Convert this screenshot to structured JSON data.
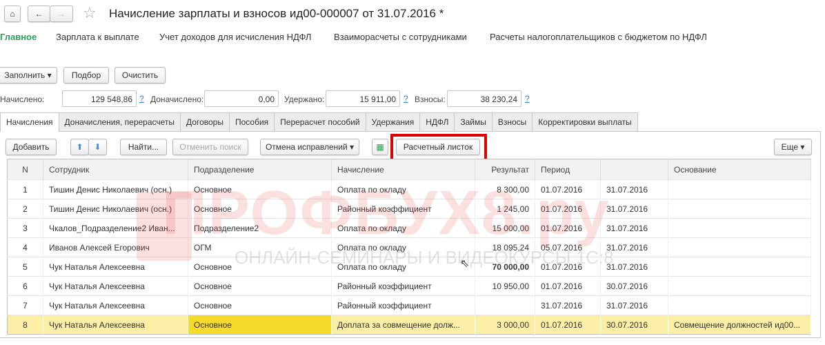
{
  "window": {
    "title": "Начисление зарплаты и взносов ид00-000007 от 31.07.2016 *"
  },
  "nav": [
    "Главное",
    "Зарплата к выплате",
    "Учет доходов для исчисления НДФЛ",
    "Взаиморасчеты с сотрудниками",
    "Расчеты налогоплательщиков с бюджетом по НДФЛ"
  ],
  "toolbar": {
    "fill": "Заполнить",
    "pick": "Подбор",
    "clear": "Очистить"
  },
  "totals": {
    "accrued_label": "Начислено:",
    "accrued": "129 548,86",
    "extra_label": "Доначислено:",
    "extra": "0,00",
    "withheld_label": "Удержано:",
    "withheld": "15 911,00",
    "contrib_label": "Взносы:",
    "contrib": "38 230,24",
    "help": "?"
  },
  "tabs": [
    "Начисления",
    "Доначисления, перерасчеты",
    "Договоры",
    "Пособия",
    "Перерасчет пособий",
    "Удержания",
    "НДФЛ",
    "Займы",
    "Взносы",
    "Корректировки выплаты"
  ],
  "table_toolbar": {
    "add": "Добавить",
    "find": "Найти...",
    "cancel_search": "Отменить поиск",
    "undo": "Отмена исправлений",
    "payslip": "Расчетный листок",
    "more": "Еще"
  },
  "columns": [
    "N",
    "Сотрудник",
    "Подразделение",
    "Начисление",
    "Результат",
    "Период",
    "",
    "Основание"
  ],
  "rows": [
    [
      "1",
      "Тишин Денис Николаевич (осн.)",
      "Основное",
      "Оплата по окладу",
      "8 300,00",
      "01.07.2016",
      "31.07.2016",
      ""
    ],
    [
      "2",
      "Тишин Денис Николаевич (осн.)",
      "Основное",
      "Районный коэффициент",
      "1 245,00",
      "01.07.2016",
      "31.07.2016",
      ""
    ],
    [
      "3",
      "Чкалов_Подразделение2 Иван...",
      "Подразделение2",
      "Оплата по окладу",
      "15 000,00",
      "01.07.2016",
      "31.07.2016",
      ""
    ],
    [
      "4",
      "Иванов Алексей Егорович",
      "ОГМ",
      "Оплата по окладу",
      "18 095,24",
      "05.07.2016",
      "31.07.2016",
      ""
    ],
    [
      "5",
      "Чук Наталья Алексеевна",
      "Основное",
      "Оплата по окладу",
      "70 000,00",
      "01.07.2016",
      "31.07.2016",
      ""
    ],
    [
      "6",
      "Чук Наталья Алексеевна",
      "Основное",
      "Районный коэффициент",
      "10 950,00",
      "01.07.2016",
      "30.07.2016",
      ""
    ],
    [
      "7",
      "Чук Наталья Алексеевна",
      "Основное",
      "Районный коэффициент",
      "",
      "31.07.2016",
      "31.07.2016",
      ""
    ],
    [
      "8",
      "Чук Наталья Алексеевна",
      "Основное",
      "Доплата за совмещение долж...",
      "3 000,00",
      "01.07.2016",
      "30.07.2016",
      "Совмещение должностей ид00..."
    ]
  ],
  "watermark": {
    "brand": "ПРОФБУХ8.ру",
    "tagline": "ОНЛАЙН-СЕМИНАРЫ И ВИДЕОКУРСЫ 1С:8"
  },
  "colors": {
    "accent_green": "#2e9e5a",
    "highlight": "#e00000",
    "selected_row": "#fbeea6",
    "selected_cell": "#f7db2a"
  }
}
